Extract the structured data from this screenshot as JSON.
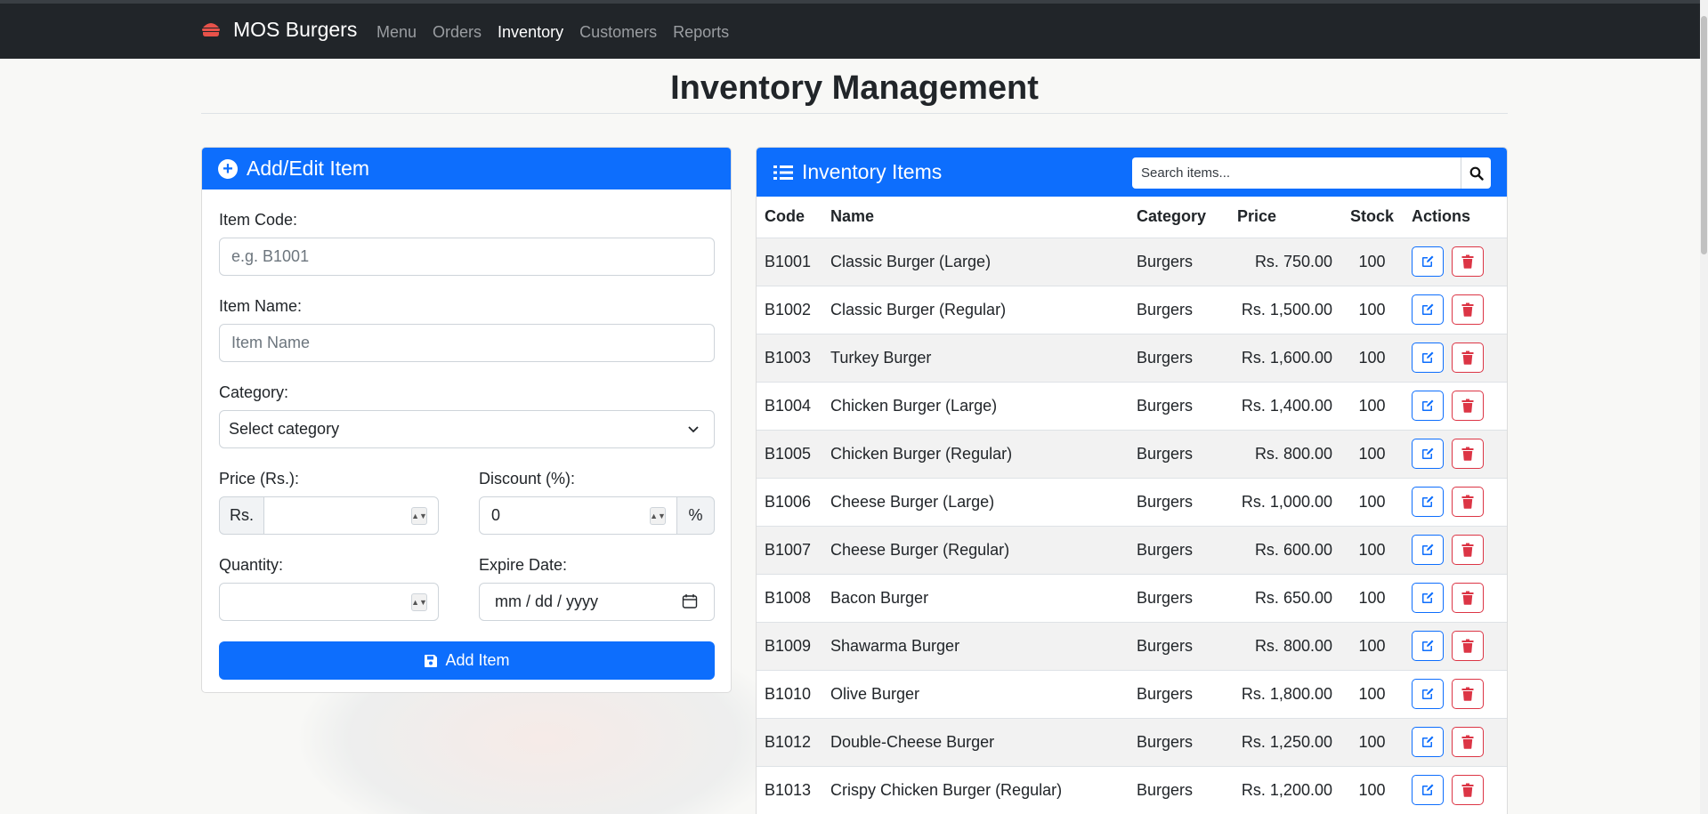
{
  "navbar": {
    "brand": "MOS Burgers",
    "links": [
      {
        "label": "Menu",
        "active": false
      },
      {
        "label": "Orders",
        "active": false
      },
      {
        "label": "Inventory",
        "active": true
      },
      {
        "label": "Customers",
        "active": false
      },
      {
        "label": "Reports",
        "active": false
      }
    ]
  },
  "page_title": "Inventory Management",
  "form": {
    "title": "Add/Edit Item",
    "item_code_label": "Item Code:",
    "item_code_placeholder": "e.g. B1001",
    "item_name_label": "Item Name:",
    "item_name_placeholder": "Item Name",
    "category_label": "Category:",
    "category_value": "Select category",
    "price_label": "Price (Rs.):",
    "price_prefix": "Rs.",
    "discount_label": "Discount (%):",
    "discount_value": "0",
    "discount_suffix": "%",
    "quantity_label": "Quantity:",
    "expire_label": "Expire Date:",
    "expire_placeholder": "mm / dd / yyyy",
    "submit_label": "Add Item"
  },
  "inventory": {
    "title": "Inventory Items",
    "search_placeholder": "Search items...",
    "columns": [
      "Code",
      "Name",
      "Category",
      "Price",
      "Stock",
      "Actions"
    ],
    "rows": [
      {
        "code": "B1001",
        "name": "Classic Burger (Large)",
        "category": "Burgers",
        "price": "Rs. 750.00",
        "stock": "100"
      },
      {
        "code": "B1002",
        "name": "Classic Burger (Regular)",
        "category": "Burgers",
        "price": "Rs. 1,500.00",
        "stock": "100"
      },
      {
        "code": "B1003",
        "name": "Turkey Burger",
        "category": "Burgers",
        "price": "Rs. 1,600.00",
        "stock": "100"
      },
      {
        "code": "B1004",
        "name": "Chicken Burger (Large)",
        "category": "Burgers",
        "price": "Rs. 1,400.00",
        "stock": "100"
      },
      {
        "code": "B1005",
        "name": "Chicken Burger (Regular)",
        "category": "Burgers",
        "price": "Rs. 800.00",
        "stock": "100"
      },
      {
        "code": "B1006",
        "name": "Cheese Burger (Large)",
        "category": "Burgers",
        "price": "Rs. 1,000.00",
        "stock": "100"
      },
      {
        "code": "B1007",
        "name": "Cheese Burger (Regular)",
        "category": "Burgers",
        "price": "Rs. 600.00",
        "stock": "100"
      },
      {
        "code": "B1008",
        "name": "Bacon Burger",
        "category": "Burgers",
        "price": "Rs. 650.00",
        "stock": "100"
      },
      {
        "code": "B1009",
        "name": "Shawarma Burger",
        "category": "Burgers",
        "price": "Rs. 800.00",
        "stock": "100"
      },
      {
        "code": "B1010",
        "name": "Olive Burger",
        "category": "Burgers",
        "price": "Rs. 1,800.00",
        "stock": "100"
      },
      {
        "code": "B1012",
        "name": "Double-Cheese Burger",
        "category": "Burgers",
        "price": "Rs. 1,250.00",
        "stock": "100"
      },
      {
        "code": "B1013",
        "name": "Crispy Chicken Burger (Regular)",
        "category": "Burgers",
        "price": "Rs. 1,200.00",
        "stock": "100"
      }
    ]
  },
  "colors": {
    "primary": "#0d6efd",
    "danger": "#dc3545",
    "navbar": "#212529",
    "brand_icon": "#e8524a"
  },
  "icons": {
    "brand": "burger-icon",
    "form_header": "plus-circle-icon",
    "table_header": "list-icon",
    "search": "search-icon",
    "submit": "save-icon",
    "edit": "edit-icon",
    "delete": "trash-icon",
    "select": "chevron-down-icon",
    "date": "calendar-icon"
  }
}
